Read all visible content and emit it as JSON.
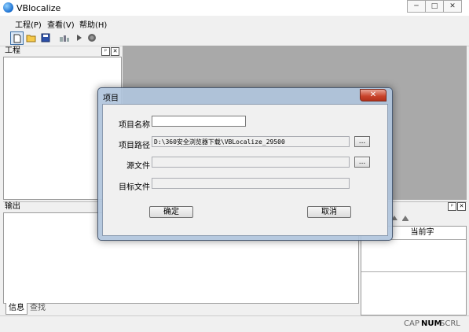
{
  "app": {
    "title": "VBlocalize"
  },
  "window_controls": {
    "minimize": "─",
    "maximize": "□",
    "close": "✕"
  },
  "menu": [
    {
      "label": "工程(P)"
    },
    {
      "label": "查看(V)"
    },
    {
      "label": "帮助(H)"
    }
  ],
  "toolbar": {
    "icons": [
      "new-file-icon",
      "open-folder-icon",
      "save-icon",
      "build-icon",
      "play-icon",
      "stop-icon"
    ]
  },
  "panels": {
    "project": {
      "title": "工程",
      "pin": "ᵖ",
      "close": "✕"
    },
    "output": {
      "title": "输出",
      "tabs": [
        {
          "label": "信息"
        },
        {
          "label": "查找"
        }
      ]
    },
    "right": {
      "pin": "ᵖ",
      "close": "✕",
      "column_header": "当前字"
    }
  },
  "status": {
    "cap": "CAP",
    "num": "NUM",
    "scrl": "SCRL"
  },
  "dialog": {
    "title": "项目",
    "close": "✕",
    "fields": {
      "name": {
        "label": "项目名称",
        "value": ""
      },
      "path": {
        "label": "项目路径",
        "value": "D:\\360安全浏览器下载\\VBLocalize_29500",
        "browse": "..."
      },
      "source": {
        "label": "源文件",
        "value": "",
        "browse": "..."
      },
      "target": {
        "label": "目标文件",
        "value": ""
      }
    },
    "ok": "确定",
    "cancel": "取消"
  },
  "colors": {
    "accent": "#c8422a",
    "workspace": "#a9a9a9"
  }
}
